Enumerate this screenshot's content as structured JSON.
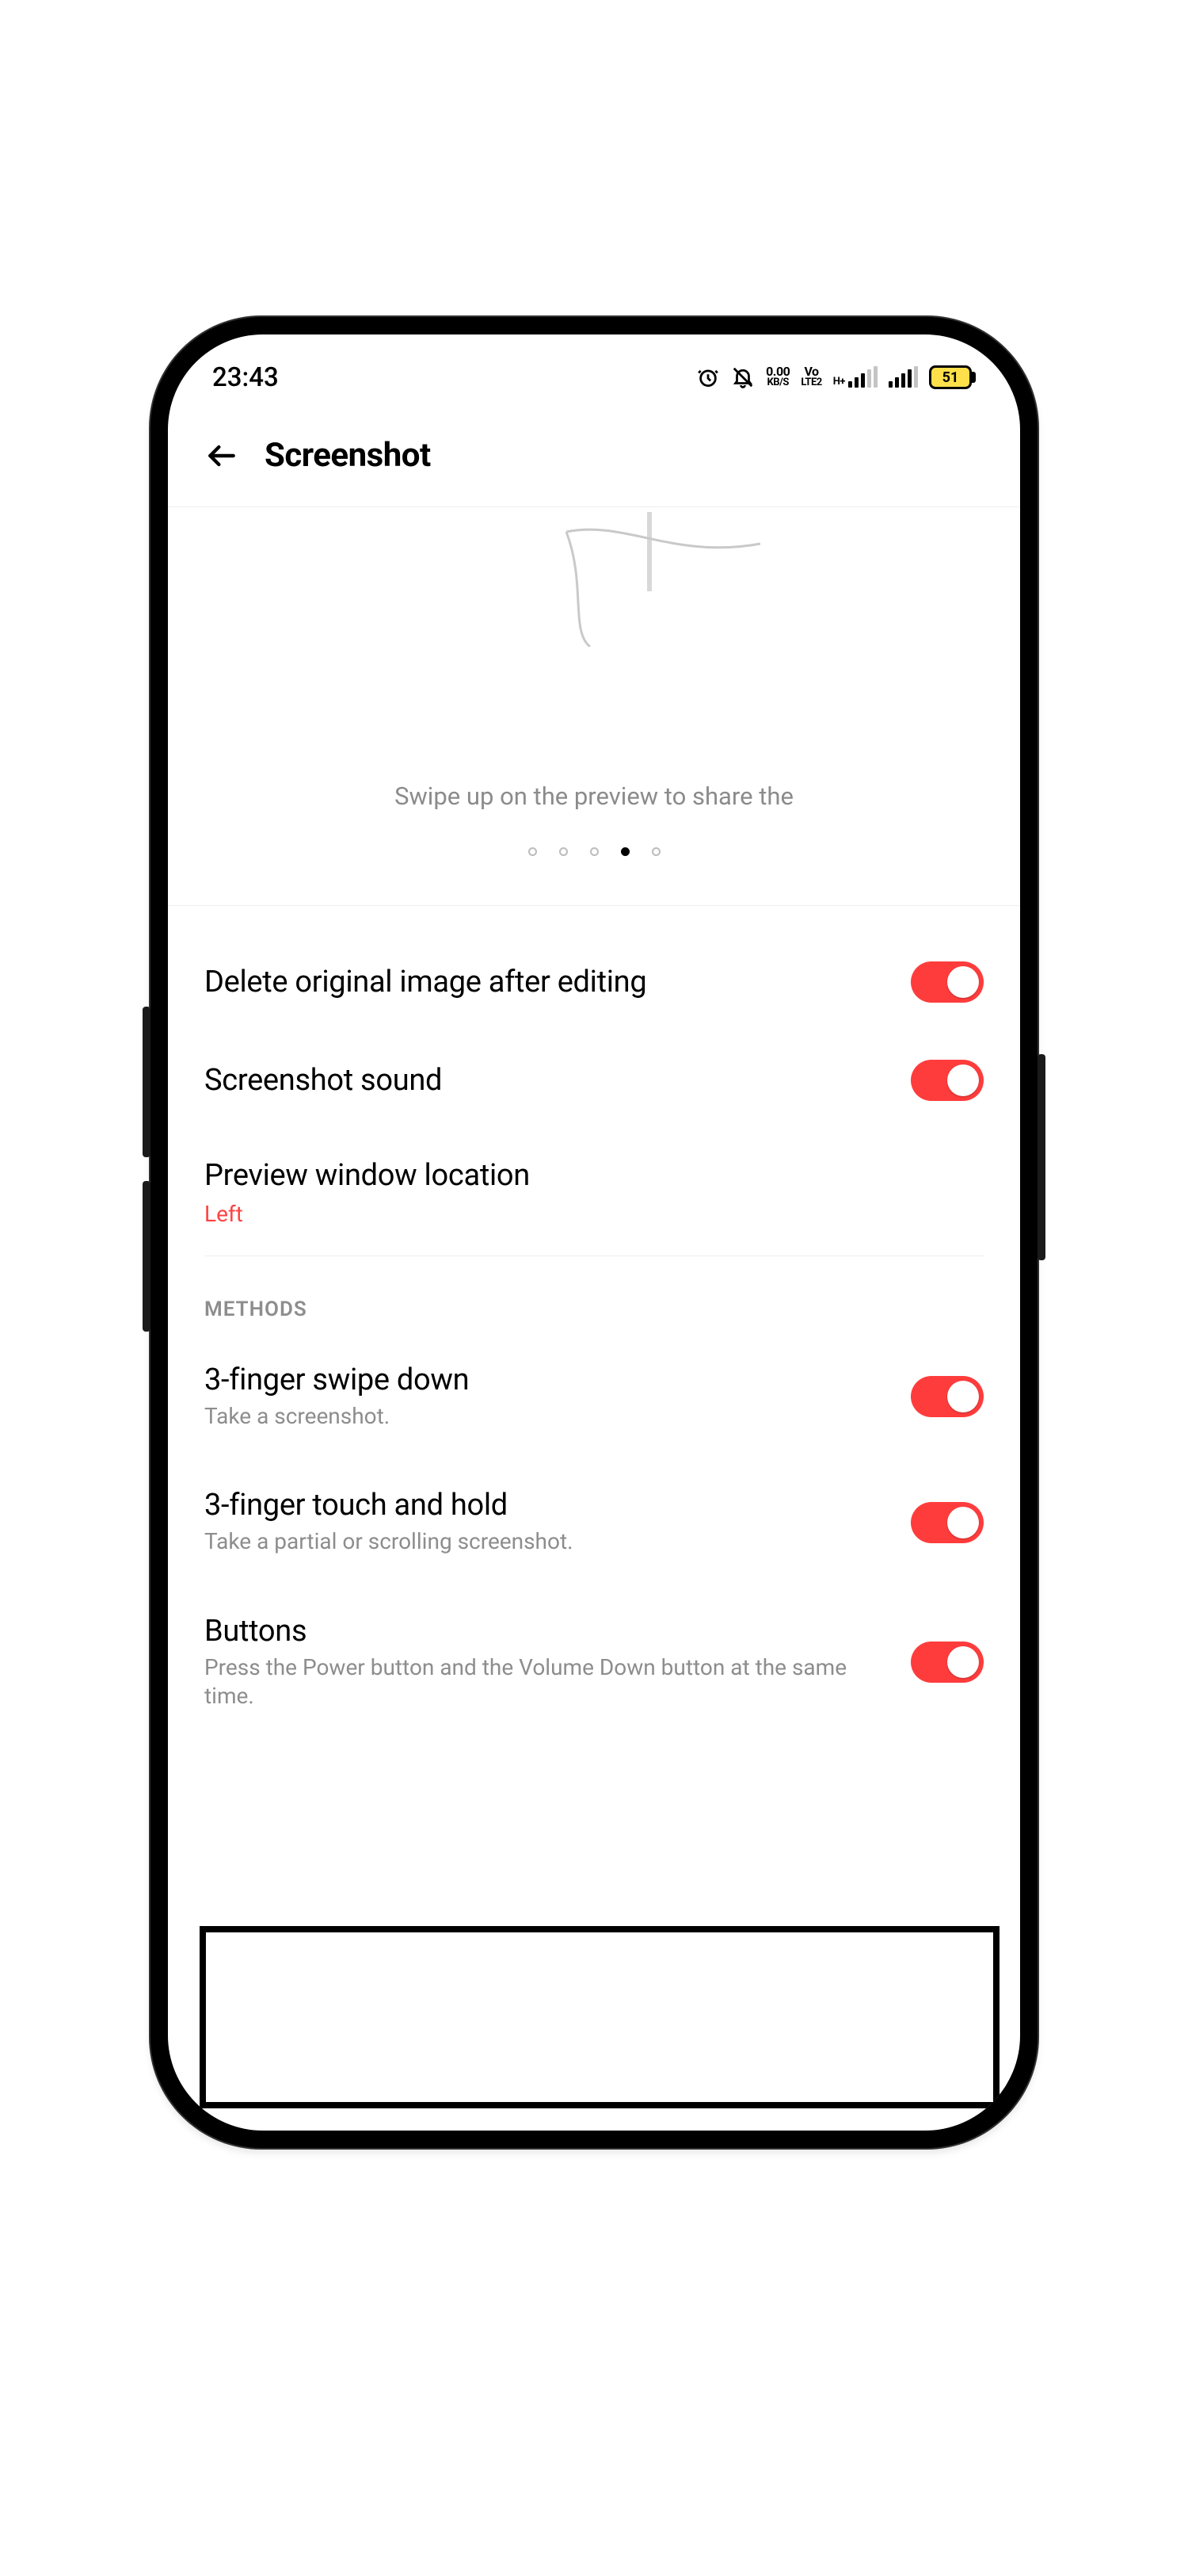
{
  "accent": "#ff3c3c",
  "statusbar": {
    "time": "23:43",
    "net_rate_top": "0.00",
    "net_rate_bot": "KB/S",
    "volte_top": "Vo",
    "volte_bot": "LTE2",
    "network_badge": "H+",
    "battery_pct": "51"
  },
  "appbar": {
    "title": "Screenshot"
  },
  "preview": {
    "caption": "Swipe up on the preview to share the",
    "page_count": 5,
    "active_page_index": 3
  },
  "settings": [
    {
      "key": "delete_original",
      "label": "Delete original image after editing",
      "toggle": true
    },
    {
      "key": "sound",
      "label": "Screenshot sound",
      "toggle": true
    },
    {
      "key": "preview_loc",
      "label": "Preview window location",
      "value": "Left"
    }
  ],
  "methods_header": "METHODS",
  "methods": [
    {
      "key": "swipe3",
      "label": "3-finger swipe down",
      "sub": "Take a screenshot.",
      "toggle": true
    },
    {
      "key": "touch3",
      "label": "3-finger touch and hold",
      "sub": "Take a partial or scrolling screenshot.",
      "toggle": true
    },
    {
      "key": "buttons",
      "label": "Buttons",
      "sub": "Press the Power button and the Volume Down button at the same time.",
      "toggle": true
    }
  ]
}
